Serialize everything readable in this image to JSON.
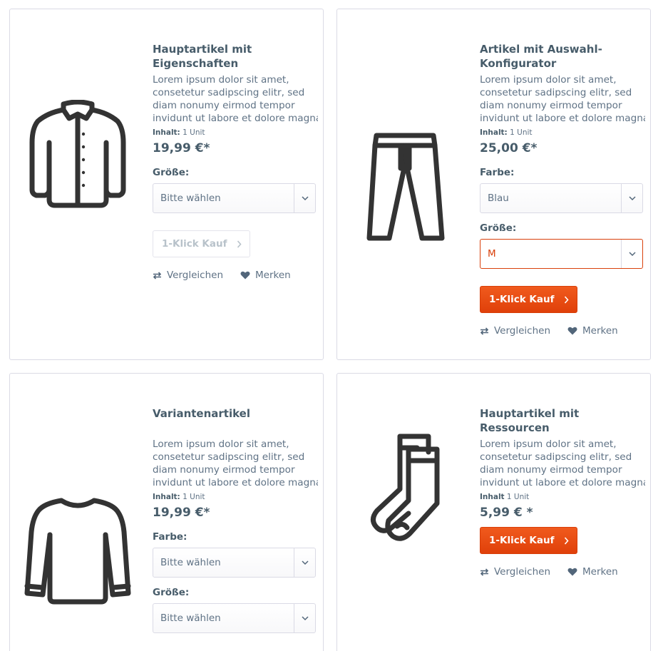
{
  "products": [
    {
      "title": "Hauptartikel mit Eigenschaften",
      "description": [
        "Lorem ipsum dolor sit amet,",
        "consetetur sadipscing elitr, sed",
        "diam nonumy eirmod tempor",
        "invidunt ut labore et dolore magna"
      ],
      "unit_label": "Inhalt:",
      "unit_value": "1 Unit",
      "price": "19,99 €*",
      "configurator": [
        {
          "label": "Größe:",
          "value": "Bitte wählen"
        }
      ],
      "buy_label": "1-Klick Kauf",
      "buy_state": "disabled",
      "compare_label": "Vergleichen",
      "remember_label": "Merken",
      "icon": "jacket-icon"
    },
    {
      "title": "Artikel mit Auswahl-Konfigurator",
      "description": [
        "Lorem ipsum dolor sit amet,",
        "consetetur sadipscing elitr, sed",
        "diam nonumy eirmod tempor",
        "invidunt ut labore et dolore magna"
      ],
      "unit_label": "Inhalt:",
      "unit_value": "1 Unit",
      "price": "25,00 €*",
      "configurator": [
        {
          "label": "Farbe:",
          "value": "Blau"
        },
        {
          "label": "Größe:",
          "value": "M",
          "state": "error"
        }
      ],
      "buy_label": "1-Klick Kauf",
      "buy_state": "active",
      "compare_label": "Vergleichen",
      "remember_label": "Merken",
      "icon": "pants-icon"
    },
    {
      "title": "Variantenartikel",
      "description": [
        "Lorem ipsum dolor sit amet,",
        "consetetur sadipscing elitr, sed",
        "diam nonumy eirmod tempor",
        "invidunt ut labore et dolore magna"
      ],
      "unit_label": "Inhalt:",
      "unit_value": "1 Unit",
      "price": "19,99 €*",
      "configurator": [
        {
          "label": "Farbe:",
          "value": "Bitte wählen"
        },
        {
          "label": "Größe:",
          "value": "Bitte wählen"
        }
      ],
      "icon": "sweater-icon"
    },
    {
      "title": "Hauptartikel mit Ressourcen",
      "description": [
        "Lorem ipsum dolor sit amet,",
        "consetetur sadipscing elitr, sed",
        "diam nonumy eirmod tempor",
        "invidunt ut labore et dolore magna"
      ],
      "unit_label": "Inhalt",
      "unit_value": "1 Unit",
      "price": "5,99 € *",
      "buy_label": "1-Klick Kauf",
      "buy_state": "active",
      "compare_label": "Vergleichen",
      "remember_label": "Merken",
      "icon": "socks-icon"
    }
  ],
  "colors": {
    "accent": "#e8490f",
    "text": "#475c6a",
    "muted": "#5f7285",
    "border": "#dadae5",
    "error": "#d9400b",
    "icon": "#333333"
  }
}
